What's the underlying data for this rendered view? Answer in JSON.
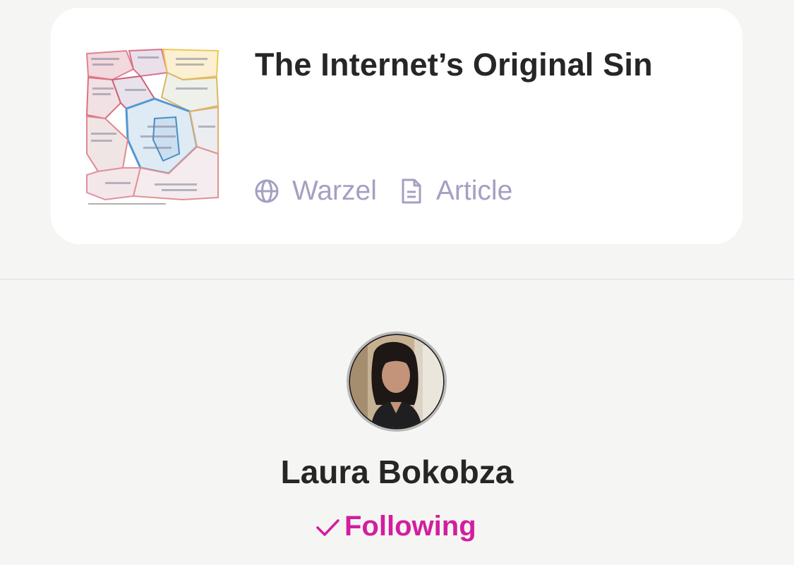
{
  "card": {
    "title": "The Internet’s Original Sin",
    "source_icon": "globe-icon",
    "source": "Warzel",
    "type_icon": "document-icon",
    "type": "Article",
    "meta_color": "#a3a0c2"
  },
  "profile": {
    "name": "Laura Bokobza",
    "follow_icon": "checkmark-icon",
    "follow_label": "Following",
    "follow_color": "#d21e9e"
  }
}
